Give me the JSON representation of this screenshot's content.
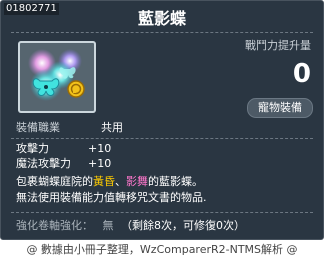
{
  "item": {
    "id": "01802771",
    "name": "藍影蝶"
  },
  "combat": {
    "label": "戰鬥力提升量",
    "value": "0"
  },
  "equip_button": {
    "label": "寵物裝備"
  },
  "job": {
    "label": "裝備職業",
    "value": "共用"
  },
  "stats": [
    {
      "label": "攻擊力",
      "value": "+10"
    },
    {
      "label": "魔法攻擊力",
      "value": "+10"
    }
  ],
  "description": {
    "line1_before": "包裹蝴蝶庭院的",
    "highlight1": "黃昏",
    "separator": "、",
    "highlight2": "影舞",
    "line1_after": "的藍影蝶。",
    "line2": "無法使用裝備能力值轉移咒文書的物品."
  },
  "upgrade": {
    "label": "強化卷軸強化：",
    "value": "無",
    "detail": "（剩餘8次，可修復0次）"
  },
  "footer": "@ 數據由小冊子整理，WzComparerR2-NTMS解析 @",
  "colors": {
    "background": "#2a3642",
    "highlight_yellow": "#ffcc00",
    "highlight_pink": "#ff77cc"
  }
}
